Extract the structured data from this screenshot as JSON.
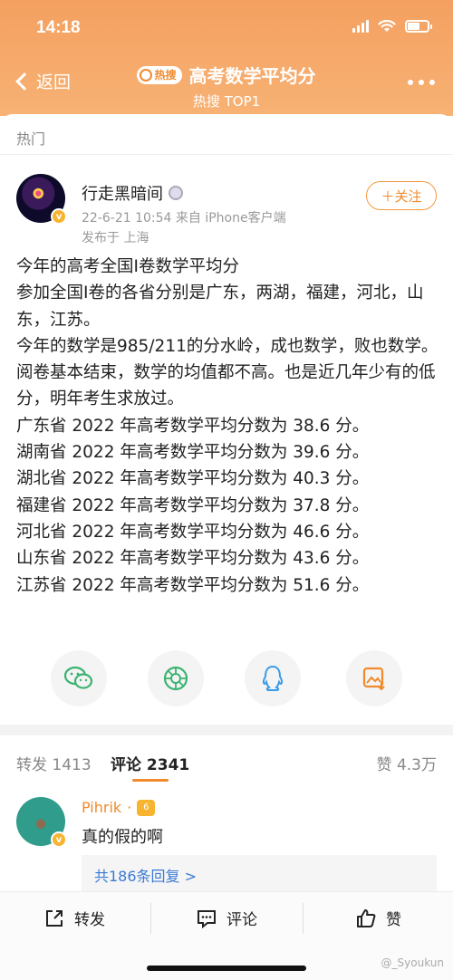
{
  "status": {
    "time": "14:18"
  },
  "nav": {
    "back_label": "返回",
    "badge": "热搜",
    "title": "高考数学平均分",
    "subtitle": "热搜 TOP1"
  },
  "section_label": "热门",
  "post": {
    "username": "行走黑暗间",
    "avatar_badge": "v",
    "meta": "22-6-21 10:54  来自 iPhone客户端",
    "location": "发布于 上海",
    "follow_label": "＋关注",
    "paragraphs": [
      "今年的高考全国I卷数学平均分",
      "参加全国I卷的各省分别是广东，两湖，福建，河北，山东，江苏。",
      "今年的数学是985/211的分水岭，成也数学，败也数学。",
      "阅卷基本结束，数学的均值都不高。也是近几年少有的低分，明年考生求放过。",
      "广东省 2022 年高考数学平均分数为 38.6 分。",
      "湖南省 2022 年高考数学平均分数为 39.6 分。",
      "湖北省 2022 年高考数学平均分数为 40.3 分。",
      "福建省 2022 年高考数学平均分数为 37.8 分。",
      "河北省 2022 年高考数学平均分数为 46.6 分。",
      "山东省 2022 年高考数学平均分数为 43.6 分。",
      "江苏省 2022 年高考数学平均分数为 51.6 分。"
    ]
  },
  "share_icons": [
    "wechat-icon",
    "moments-icon",
    "qq-icon",
    "save-image-icon"
  ],
  "tabs": {
    "repost": "转发 1413",
    "comment": "评论 2341",
    "like": "赞 4.3万"
  },
  "comment": {
    "username": "Pihrik",
    "badge": "v",
    "vip_label": "6",
    "text": "真的假的啊",
    "replies": "共186条回复 >"
  },
  "bottom_bar": {
    "repost": "转发",
    "comment": "评论",
    "like": "赞"
  },
  "watermark": "@_Syoukun",
  "colors": {
    "accent": "#f08a2c",
    "header": "#f4a060",
    "link": "#3a7bd5"
  }
}
